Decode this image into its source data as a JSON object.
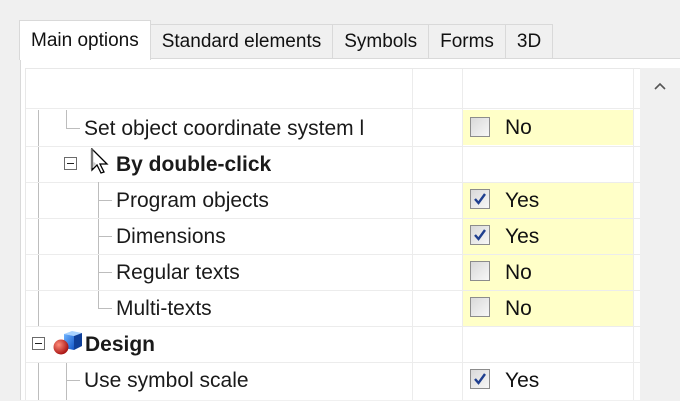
{
  "tabs": [
    "Main options",
    "Standard elements",
    "Symbols",
    "Forms",
    "3D"
  ],
  "rows": [
    {
      "label": "Set object coordinate system l",
      "value": "No",
      "checked": false,
      "highlight": true
    },
    {
      "label": "By double-click"
    },
    {
      "label": "Program objects",
      "value": "Yes",
      "checked": true,
      "highlight": true
    },
    {
      "label": "Dimensions",
      "value": "Yes",
      "checked": true,
      "highlight": true
    },
    {
      "label": "Regular texts",
      "value": "No",
      "checked": false,
      "highlight": true
    },
    {
      "label": "Multi-texts",
      "value": "No",
      "checked": false,
      "highlight": true
    },
    {
      "label": "Design"
    },
    {
      "label": "Use symbol scale",
      "value": "Yes",
      "checked": true,
      "highlight": false
    }
  ]
}
